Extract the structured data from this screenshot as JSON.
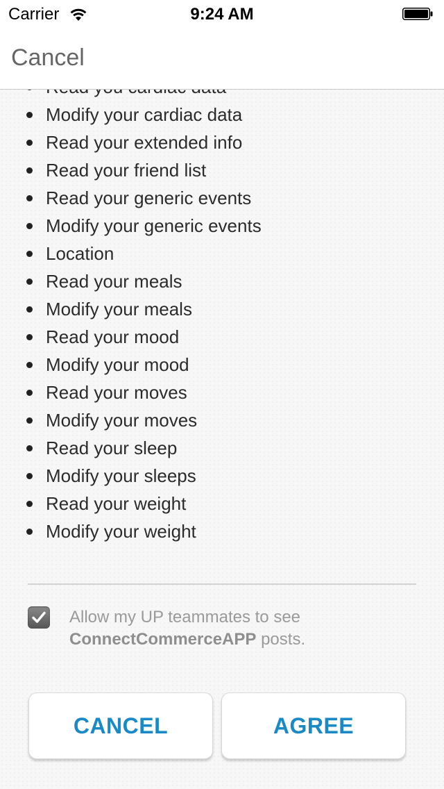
{
  "status_bar": {
    "carrier": "Carrier",
    "time": "9:24 AM",
    "wifi_icon": "wifi-icon",
    "battery_icon": "battery-icon"
  },
  "nav": {
    "cancel_label": "Cancel"
  },
  "permissions": [
    "Read you cardiac data",
    "Modify your cardiac data",
    "Read your extended info",
    "Read your friend list",
    "Read your generic events",
    "Modify your generic events",
    "Location",
    "Read your meals",
    "Modify your meals",
    "Read your mood",
    "Modify your mood",
    "Read your moves",
    "Modify your moves",
    "Read your sleep",
    "Modify your sleeps",
    "Read your weight",
    "Modify your weight"
  ],
  "sharing": {
    "checked": true,
    "text_before": "Allow my UP teammates to see",
    "app_name": "ConnectCommerceAPP",
    "text_after": "posts."
  },
  "actions": {
    "cancel_label": "CANCEL",
    "agree_label": "AGREE"
  },
  "colors": {
    "button_text": "#1a8ac6",
    "nav_text": "#666666",
    "checkbox_fill": "#666666"
  }
}
